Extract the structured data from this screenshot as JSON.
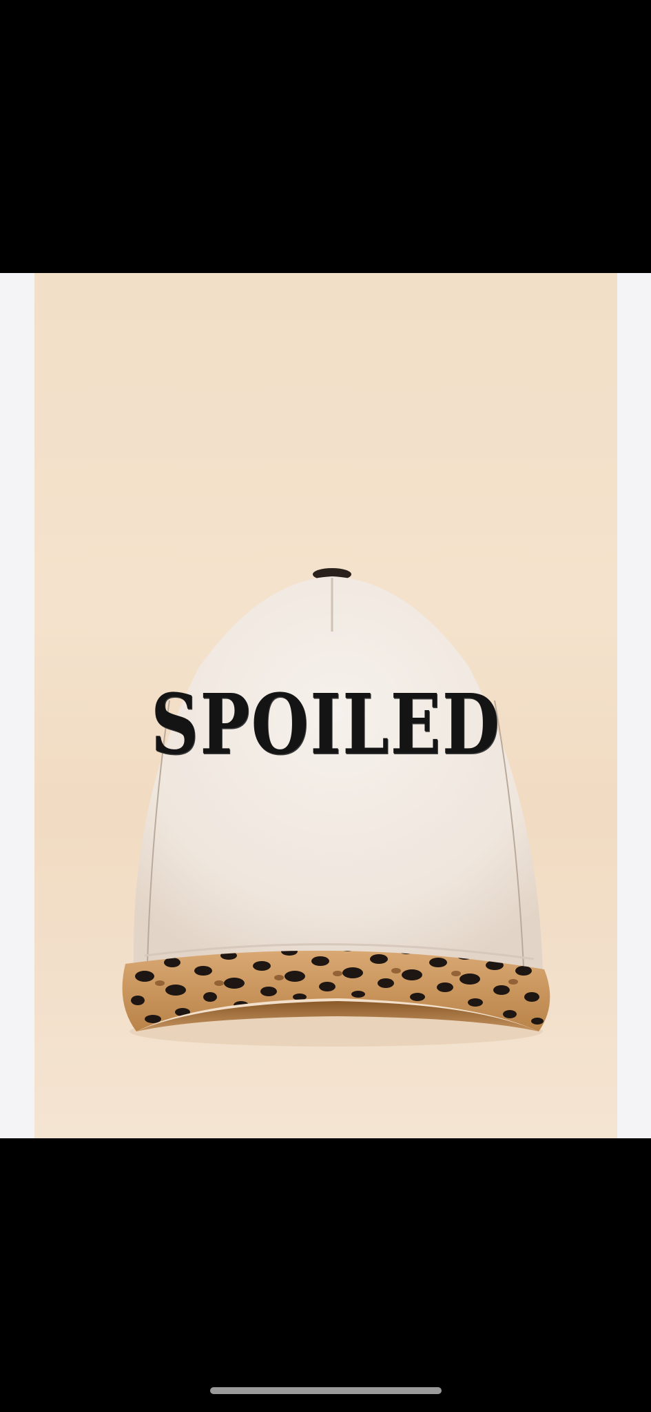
{
  "photo": {
    "subject": "baseball-cap",
    "embroidered_text": "SPOILED",
    "colors": {
      "background": "#f2dfc8",
      "crown": "#f1ebe4",
      "brim_base": "#c9935a",
      "spots": "#1e1612",
      "embroidery": "#141414"
    }
  },
  "system": {
    "home_indicator_icon": "home-indicator-bar"
  }
}
